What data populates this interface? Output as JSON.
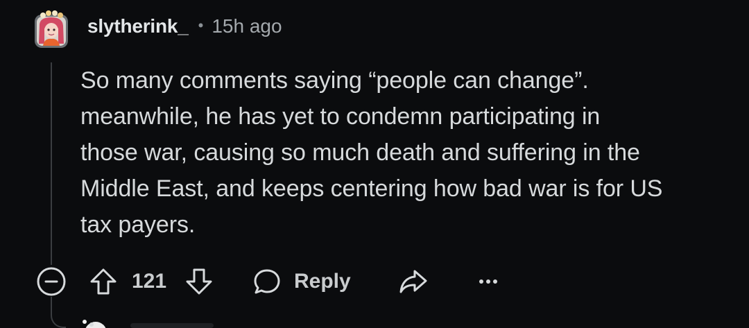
{
  "comment": {
    "username": "slytherink_",
    "separator": "•",
    "timestamp": "15h ago",
    "body": "So many comments saying “people can change”.\nmeanwhile, he has yet to condemn participating in\nthose war, causing so much death and suffering in the\nMiddle East, and keeps centering how bad war is for US\ntax payers.",
    "vote_count": "121",
    "reply_label": "Reply"
  },
  "icons": {
    "avatar": "user-avatar",
    "collapse": "collapse-minus-icon",
    "upvote": "upvote-arrow-icon",
    "downvote": "downvote-arrow-icon",
    "reply": "speech-bubble-icon",
    "share": "share-arrow-icon",
    "more": "more-options-icon"
  },
  "colors": {
    "background": "#0b0c0e",
    "text": "#d7dadc",
    "muted": "#a4a9ad",
    "thread_line": "#3a3d40"
  }
}
